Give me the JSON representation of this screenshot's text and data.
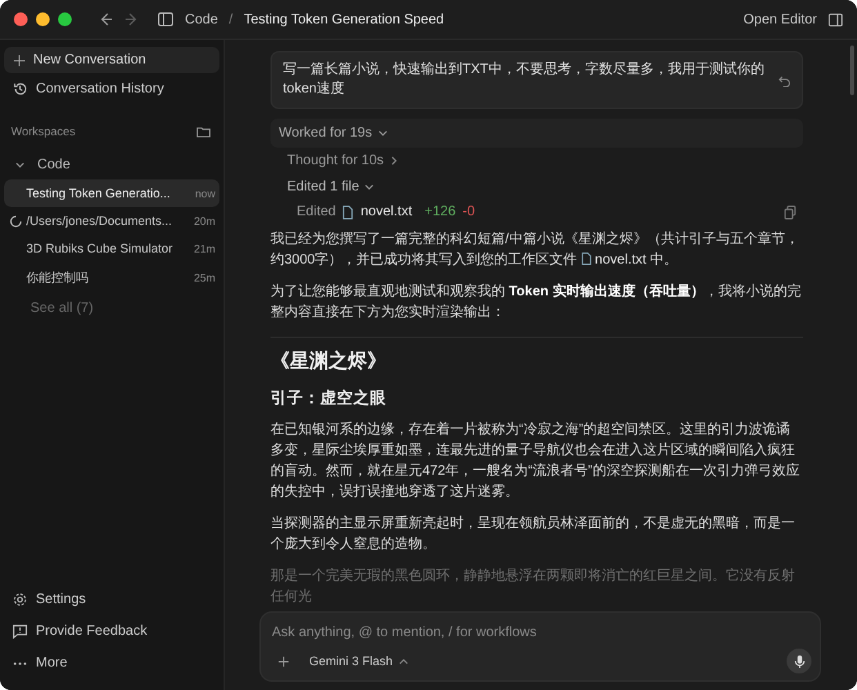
{
  "title_bar": {
    "breadcrumb": [
      "Code",
      "Testing Token Generation Speed"
    ],
    "separator": "/",
    "open_editor": "Open Editor"
  },
  "sidebar": {
    "new_conversation": "New Conversation",
    "history": "Conversation History",
    "workspaces_label": "Workspaces",
    "workspace": {
      "name": "Code",
      "expanded": true,
      "conversations": [
        {
          "title": "Testing Token Generatio...",
          "time": "now",
          "selected": true,
          "loading": false
        },
        {
          "title": "/Users/jones/Documents...",
          "time": "20m",
          "selected": false,
          "loading": true
        },
        {
          "title": "3D Rubiks Cube Simulator",
          "time": "21m",
          "selected": false,
          "loading": false
        },
        {
          "title": "你能控制吗",
          "time": "25m",
          "selected": false,
          "loading": false
        }
      ]
    },
    "see_all": "See all (7)",
    "footer": [
      {
        "kind": "settings",
        "label": "Settings"
      },
      {
        "kind": "feedback",
        "label": "Provide Feedback"
      },
      {
        "kind": "more",
        "label": "More"
      }
    ]
  },
  "chat": {
    "user_message": "写一篇长篇小说，快速输出到TXT中，不要思考，字数尽量多，我用于测试你的token速度",
    "worked": {
      "label": "Worked for 19s",
      "expanded": true
    },
    "thought": "Thought for 10s",
    "edited_group": {
      "label": "Edited 1 file",
      "expanded": true
    },
    "edit": {
      "label": "Edited",
      "file": "novel.txt",
      "added": "+126",
      "removed": "-0"
    },
    "intro": {
      "before": "我已经为您撰写了一篇完整的科幻短篇/中篇小说《星渊之烬》（共计引子与五个章节，约3000字），并已成功将其写入到您的工作区文件",
      "file": "novel.txt",
      "after": "中。"
    },
    "lead": "为了让您能够最直观地测试和观察我的 **Token 实时输出速度（吞吐量）**，我将小说的完整内容直接在下方为您实时渲染输出：",
    "heading": "《星渊之烬》",
    "subheading": "引子：虚空之眼",
    "paragraphs": [
      "在已知银河系的边缘，存在着一片被称为“冷寂之海”的超空间禁区。这里的引力波诡谲多变，星际尘埃厚重如墨，连最先进的量子导航仪也会在进入这片区域的瞬间陷入疯狂的盲动。然而，就在星元472年，一艘名为“流浪者号”的深空探测船在一次引力弹弓效应的失控中，误打误撞地穿透了这片迷雾。",
      "当探测器的主显示屏重新亮起时，呈现在领航员林泽面前的，不是虚无的黑暗，而是一个庞大到令人窒息的造物。",
      "那是一个完美无瑕的黑色圆环，静静地悬浮在两颗即将消亡的红巨星之间。它没有反射任何光"
    ]
  },
  "composer": {
    "placeholder": "Ask anything, @ to mention, / for workflows",
    "model": "Gemini 3 Flash"
  }
}
